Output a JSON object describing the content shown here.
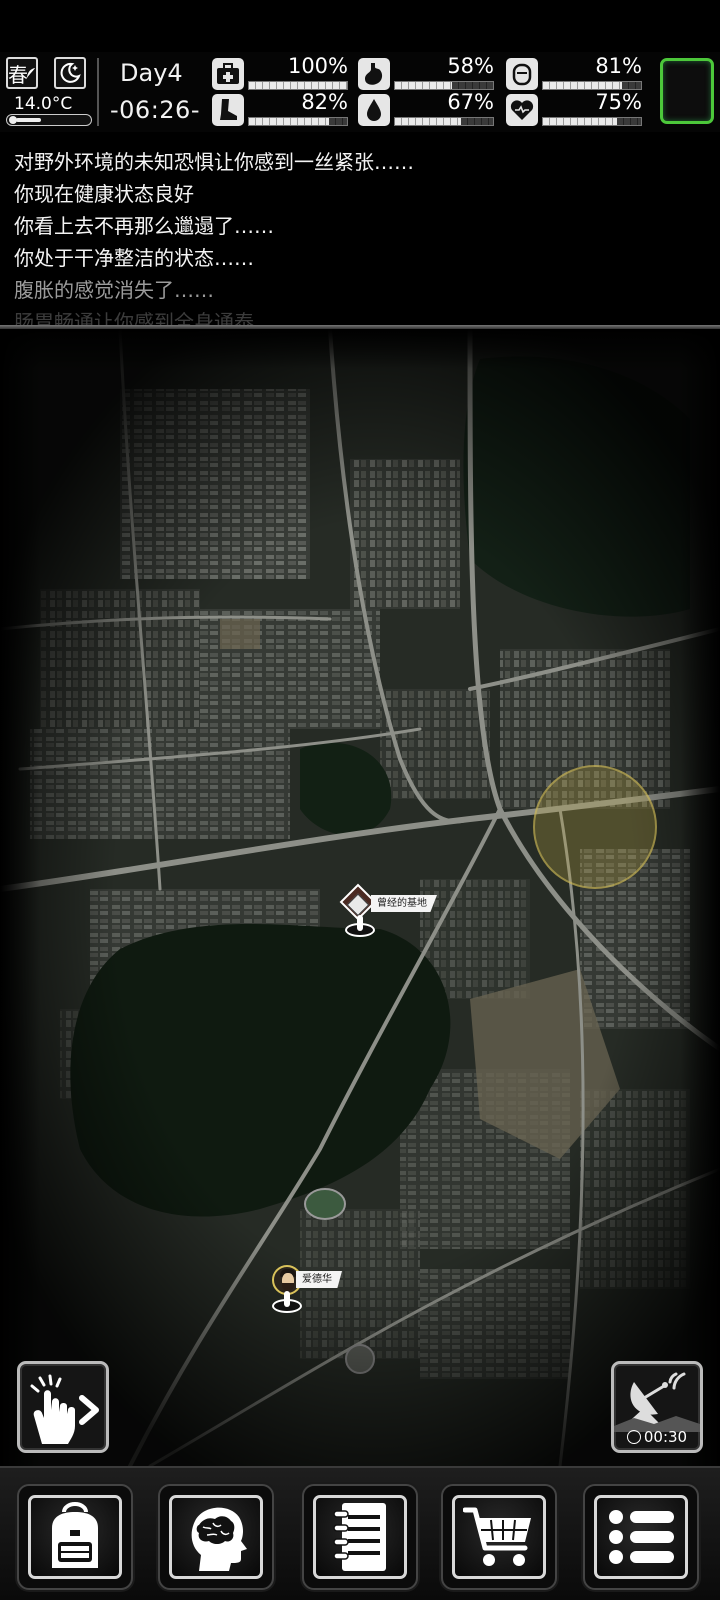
{
  "hud": {
    "season": "春",
    "season_icon": "feather-icon",
    "weather_icon": "moon-star-icon",
    "temperature": "14.0°C",
    "temperature_level": 0.35,
    "day": "Day4",
    "time": "-06:26-",
    "stats": [
      {
        "name": "health",
        "icon": "medkit-icon",
        "value": "100%",
        "level": 1.0
      },
      {
        "name": "hunger",
        "icon": "stomach-icon",
        "value": "58%",
        "level": 0.58
      },
      {
        "name": "cleanliness",
        "icon": "soap-icon",
        "value": "81%",
        "level": 0.81
      },
      {
        "name": "stamina",
        "icon": "boot-icon",
        "value": "82%",
        "level": 0.82
      },
      {
        "name": "thirst",
        "icon": "water-drop-icon",
        "value": "67%",
        "level": 0.67
      },
      {
        "name": "mood",
        "icon": "heart-icon",
        "value": "75%",
        "level": 0.75
      }
    ],
    "accent_color": "#4cc73a"
  },
  "log": {
    "lines": [
      "对野外环境的未知恐惧让你感到一丝紧张……",
      "你现在健康状态良好",
      "你看上去不再那么邋遢了……",
      "你处于干净整洁的状态……",
      "腹胀的感觉消失了……",
      "肠胃畅通让你感到全身通泰"
    ]
  },
  "map": {
    "markers": [
      {
        "label": "曾经的基地",
        "icon": "base-icon"
      },
      {
        "label": "爱德华",
        "icon": "avatar-icon"
      }
    ],
    "zone_color": "#bea a46",
    "tap_button_icon": "tap-hand-arrow-icon",
    "radar_icon": "satellite-dish-icon",
    "radar_time": "00:30"
  },
  "bottom_nav": [
    {
      "name": "backpack",
      "icon": "backpack-icon"
    },
    {
      "name": "skills",
      "icon": "brain-head-icon"
    },
    {
      "name": "journal",
      "icon": "notebook-icon"
    },
    {
      "name": "shop",
      "icon": "cart-icon"
    },
    {
      "name": "menu",
      "icon": "menu-icon"
    }
  ]
}
